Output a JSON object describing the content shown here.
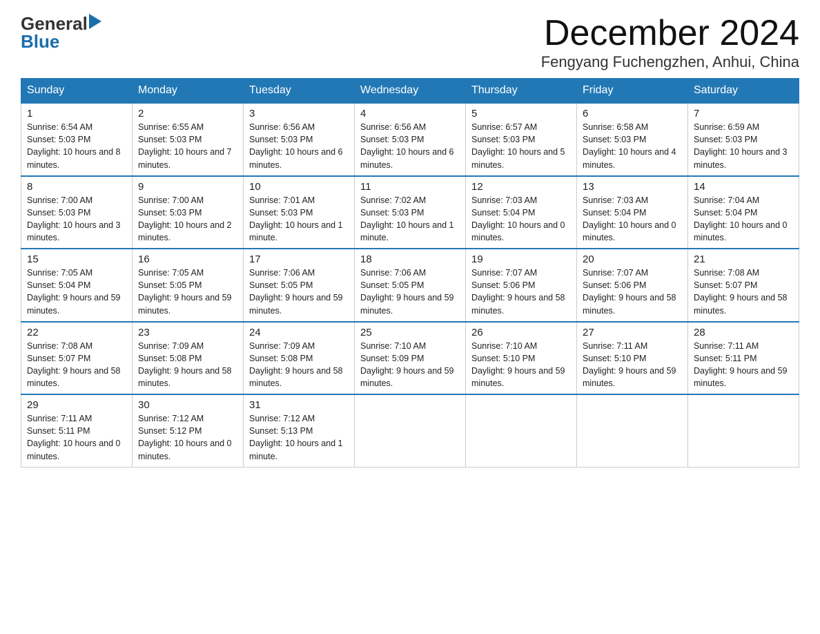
{
  "header": {
    "logo_general": "General",
    "logo_blue": "Blue",
    "month_title": "December 2024",
    "location": "Fengyang Fuchengzhen, Anhui, China"
  },
  "days_of_week": [
    "Sunday",
    "Monday",
    "Tuesday",
    "Wednesday",
    "Thursday",
    "Friday",
    "Saturday"
  ],
  "weeks": [
    [
      {
        "day": "1",
        "sunrise": "6:54 AM",
        "sunset": "5:03 PM",
        "daylight": "10 hours and 8 minutes."
      },
      {
        "day": "2",
        "sunrise": "6:55 AM",
        "sunset": "5:03 PM",
        "daylight": "10 hours and 7 minutes."
      },
      {
        "day": "3",
        "sunrise": "6:56 AM",
        "sunset": "5:03 PM",
        "daylight": "10 hours and 6 minutes."
      },
      {
        "day": "4",
        "sunrise": "6:56 AM",
        "sunset": "5:03 PM",
        "daylight": "10 hours and 6 minutes."
      },
      {
        "day": "5",
        "sunrise": "6:57 AM",
        "sunset": "5:03 PM",
        "daylight": "10 hours and 5 minutes."
      },
      {
        "day": "6",
        "sunrise": "6:58 AM",
        "sunset": "5:03 PM",
        "daylight": "10 hours and 4 minutes."
      },
      {
        "day": "7",
        "sunrise": "6:59 AM",
        "sunset": "5:03 PM",
        "daylight": "10 hours and 3 minutes."
      }
    ],
    [
      {
        "day": "8",
        "sunrise": "7:00 AM",
        "sunset": "5:03 PM",
        "daylight": "10 hours and 3 minutes."
      },
      {
        "day": "9",
        "sunrise": "7:00 AM",
        "sunset": "5:03 PM",
        "daylight": "10 hours and 2 minutes."
      },
      {
        "day": "10",
        "sunrise": "7:01 AM",
        "sunset": "5:03 PM",
        "daylight": "10 hours and 1 minute."
      },
      {
        "day": "11",
        "sunrise": "7:02 AM",
        "sunset": "5:03 PM",
        "daylight": "10 hours and 1 minute."
      },
      {
        "day": "12",
        "sunrise": "7:03 AM",
        "sunset": "5:04 PM",
        "daylight": "10 hours and 0 minutes."
      },
      {
        "day": "13",
        "sunrise": "7:03 AM",
        "sunset": "5:04 PM",
        "daylight": "10 hours and 0 minutes."
      },
      {
        "day": "14",
        "sunrise": "7:04 AM",
        "sunset": "5:04 PM",
        "daylight": "10 hours and 0 minutes."
      }
    ],
    [
      {
        "day": "15",
        "sunrise": "7:05 AM",
        "sunset": "5:04 PM",
        "daylight": "9 hours and 59 minutes."
      },
      {
        "day": "16",
        "sunrise": "7:05 AM",
        "sunset": "5:05 PM",
        "daylight": "9 hours and 59 minutes."
      },
      {
        "day": "17",
        "sunrise": "7:06 AM",
        "sunset": "5:05 PM",
        "daylight": "9 hours and 59 minutes."
      },
      {
        "day": "18",
        "sunrise": "7:06 AM",
        "sunset": "5:05 PM",
        "daylight": "9 hours and 59 minutes."
      },
      {
        "day": "19",
        "sunrise": "7:07 AM",
        "sunset": "5:06 PM",
        "daylight": "9 hours and 58 minutes."
      },
      {
        "day": "20",
        "sunrise": "7:07 AM",
        "sunset": "5:06 PM",
        "daylight": "9 hours and 58 minutes."
      },
      {
        "day": "21",
        "sunrise": "7:08 AM",
        "sunset": "5:07 PM",
        "daylight": "9 hours and 58 minutes."
      }
    ],
    [
      {
        "day": "22",
        "sunrise": "7:08 AM",
        "sunset": "5:07 PM",
        "daylight": "9 hours and 58 minutes."
      },
      {
        "day": "23",
        "sunrise": "7:09 AM",
        "sunset": "5:08 PM",
        "daylight": "9 hours and 58 minutes."
      },
      {
        "day": "24",
        "sunrise": "7:09 AM",
        "sunset": "5:08 PM",
        "daylight": "9 hours and 58 minutes."
      },
      {
        "day": "25",
        "sunrise": "7:10 AM",
        "sunset": "5:09 PM",
        "daylight": "9 hours and 59 minutes."
      },
      {
        "day": "26",
        "sunrise": "7:10 AM",
        "sunset": "5:10 PM",
        "daylight": "9 hours and 59 minutes."
      },
      {
        "day": "27",
        "sunrise": "7:11 AM",
        "sunset": "5:10 PM",
        "daylight": "9 hours and 59 minutes."
      },
      {
        "day": "28",
        "sunrise": "7:11 AM",
        "sunset": "5:11 PM",
        "daylight": "9 hours and 59 minutes."
      }
    ],
    [
      {
        "day": "29",
        "sunrise": "7:11 AM",
        "sunset": "5:11 PM",
        "daylight": "10 hours and 0 minutes."
      },
      {
        "day": "30",
        "sunrise": "7:12 AM",
        "sunset": "5:12 PM",
        "daylight": "10 hours and 0 minutes."
      },
      {
        "day": "31",
        "sunrise": "7:12 AM",
        "sunset": "5:13 PM",
        "daylight": "10 hours and 1 minute."
      },
      null,
      null,
      null,
      null
    ]
  ],
  "labels": {
    "sunrise": "Sunrise:",
    "sunset": "Sunset:",
    "daylight": "Daylight:"
  }
}
